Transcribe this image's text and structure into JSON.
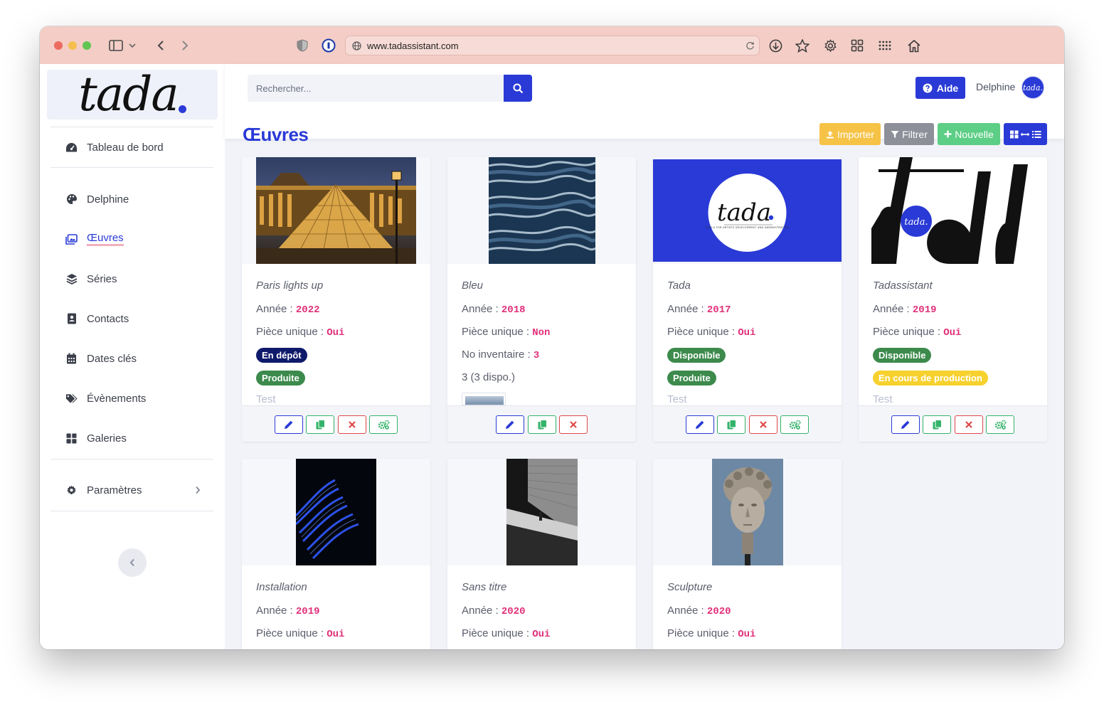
{
  "browser": {
    "url": "www.tadassistant.com"
  },
  "sidebar": {
    "logo_text": "tada",
    "items": [
      {
        "label": "Tableau de bord",
        "icon": "dashboard-icon"
      },
      {
        "label": "Delphine",
        "icon": "palette-icon"
      },
      {
        "label": "Œuvres",
        "icon": "images-icon",
        "active": true
      },
      {
        "label": "Séries",
        "icon": "layers-icon"
      },
      {
        "label": "Contacts",
        "icon": "address-book-icon"
      },
      {
        "label": "Dates clés",
        "icon": "calendar-icon"
      },
      {
        "label": "Évènements",
        "icon": "tags-icon"
      },
      {
        "label": "Galeries",
        "icon": "grid-icon"
      },
      {
        "label": "Paramètres",
        "icon": "gear-icon"
      }
    ]
  },
  "topbar": {
    "search_placeholder": "Rechercher...",
    "help_label": "Aide",
    "user_name": "Delphine",
    "avatar_text": "tada."
  },
  "page": {
    "title": "Œuvres",
    "toolbar": {
      "import_label": "Importer",
      "filter_label": "Filtrer",
      "new_label": "Nouvelle"
    }
  },
  "colors": {
    "primary": "#2a3ad6",
    "accent_value": "#e0307a",
    "badge_depot": "#101a6b",
    "badge_green": "#3c8a4c",
    "badge_yellow": "#f7d12e",
    "import_btn": "#f6c347",
    "filter_btn": "#8d8f99",
    "new_btn": "#5dce85"
  },
  "labels": {
    "annee": "Année : ",
    "piece_unique": "Pièce unique : ",
    "no_inventaire": "No inventaire : "
  },
  "cards": [
    {
      "title": "Paris lights up",
      "annee": "2022",
      "piece_unique": "Oui",
      "badges": [
        "En dépôt",
        "Produite"
      ],
      "extra": "Test"
    },
    {
      "title": "Bleu",
      "annee": "2018",
      "piece_unique": "Non",
      "no_inventaire": "3",
      "stock": "3 (3 dispo.)"
    },
    {
      "title": "Tada",
      "annee": "2017",
      "piece_unique": "Oui",
      "badges": [
        "Disponible",
        "Produite"
      ],
      "extra": "Test",
      "image_caption": "TOOLS FOR ARTISTS DEVELOPMENT AND ADMINISTRATION"
    },
    {
      "title": "Tadassistant",
      "annee": "2019",
      "piece_unique": "Oui",
      "badges": [
        "Disponible",
        "En cours de production"
      ],
      "extra": "Test"
    },
    {
      "title": "Installation",
      "annee": "2019",
      "piece_unique": "Oui"
    },
    {
      "title": "Sans titre",
      "annee": "2020",
      "piece_unique": "Oui"
    },
    {
      "title": "Sculpture",
      "annee": "2020",
      "piece_unique": "Oui"
    }
  ]
}
